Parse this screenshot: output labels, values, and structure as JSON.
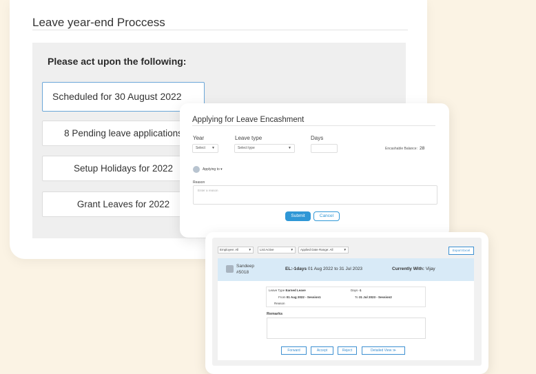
{
  "card1": {
    "title": "Leave year-end Proccess",
    "prompt": "Please act upon the following:",
    "options": [
      "Scheduled for 30 August 2022",
      "8 Pending leave applications",
      "Setup Holidays for 2022",
      "Grant Leaves for 2022"
    ]
  },
  "card2": {
    "title": "Applying for Leave Encashment",
    "year_label": "Year",
    "year_value": "Select",
    "leave_type_label": "Leave type",
    "leave_type_value": "Select type",
    "days_label": "Days",
    "encashable_label": "Encashable Balance:",
    "encashable_value": "28",
    "applying_to": "Applying to",
    "reason_label": "Reason",
    "reason_placeholder": "Enter a reason",
    "submit": "Submit",
    "cancel": "Cancel"
  },
  "card3": {
    "filters": [
      "Employee: All",
      "List:Active",
      "Applied Date Range: All"
    ],
    "export": "Export Excel",
    "employee_name": "Sandeep",
    "employee_id": "#5018",
    "el_days": "EL:-1days",
    "el_range": "01 Aug 2022 to 31 Jul 2023",
    "currently_with_label": "Currently With:",
    "currently_with": "Vijay",
    "leave_type_label": "Leave Type",
    "leave_type": "Earned Leave",
    "days_label": "Days",
    "days": "-1",
    "from_label": "From",
    "from": "01 Aug 2022 - Session1",
    "to_label": "To",
    "to": "31 Jul 2023 - Session2",
    "reason_label": "Reason",
    "remarks_label": "Remarks",
    "actions": [
      "Forward",
      "Accept",
      "Reject",
      "Detailed View ≫"
    ]
  }
}
